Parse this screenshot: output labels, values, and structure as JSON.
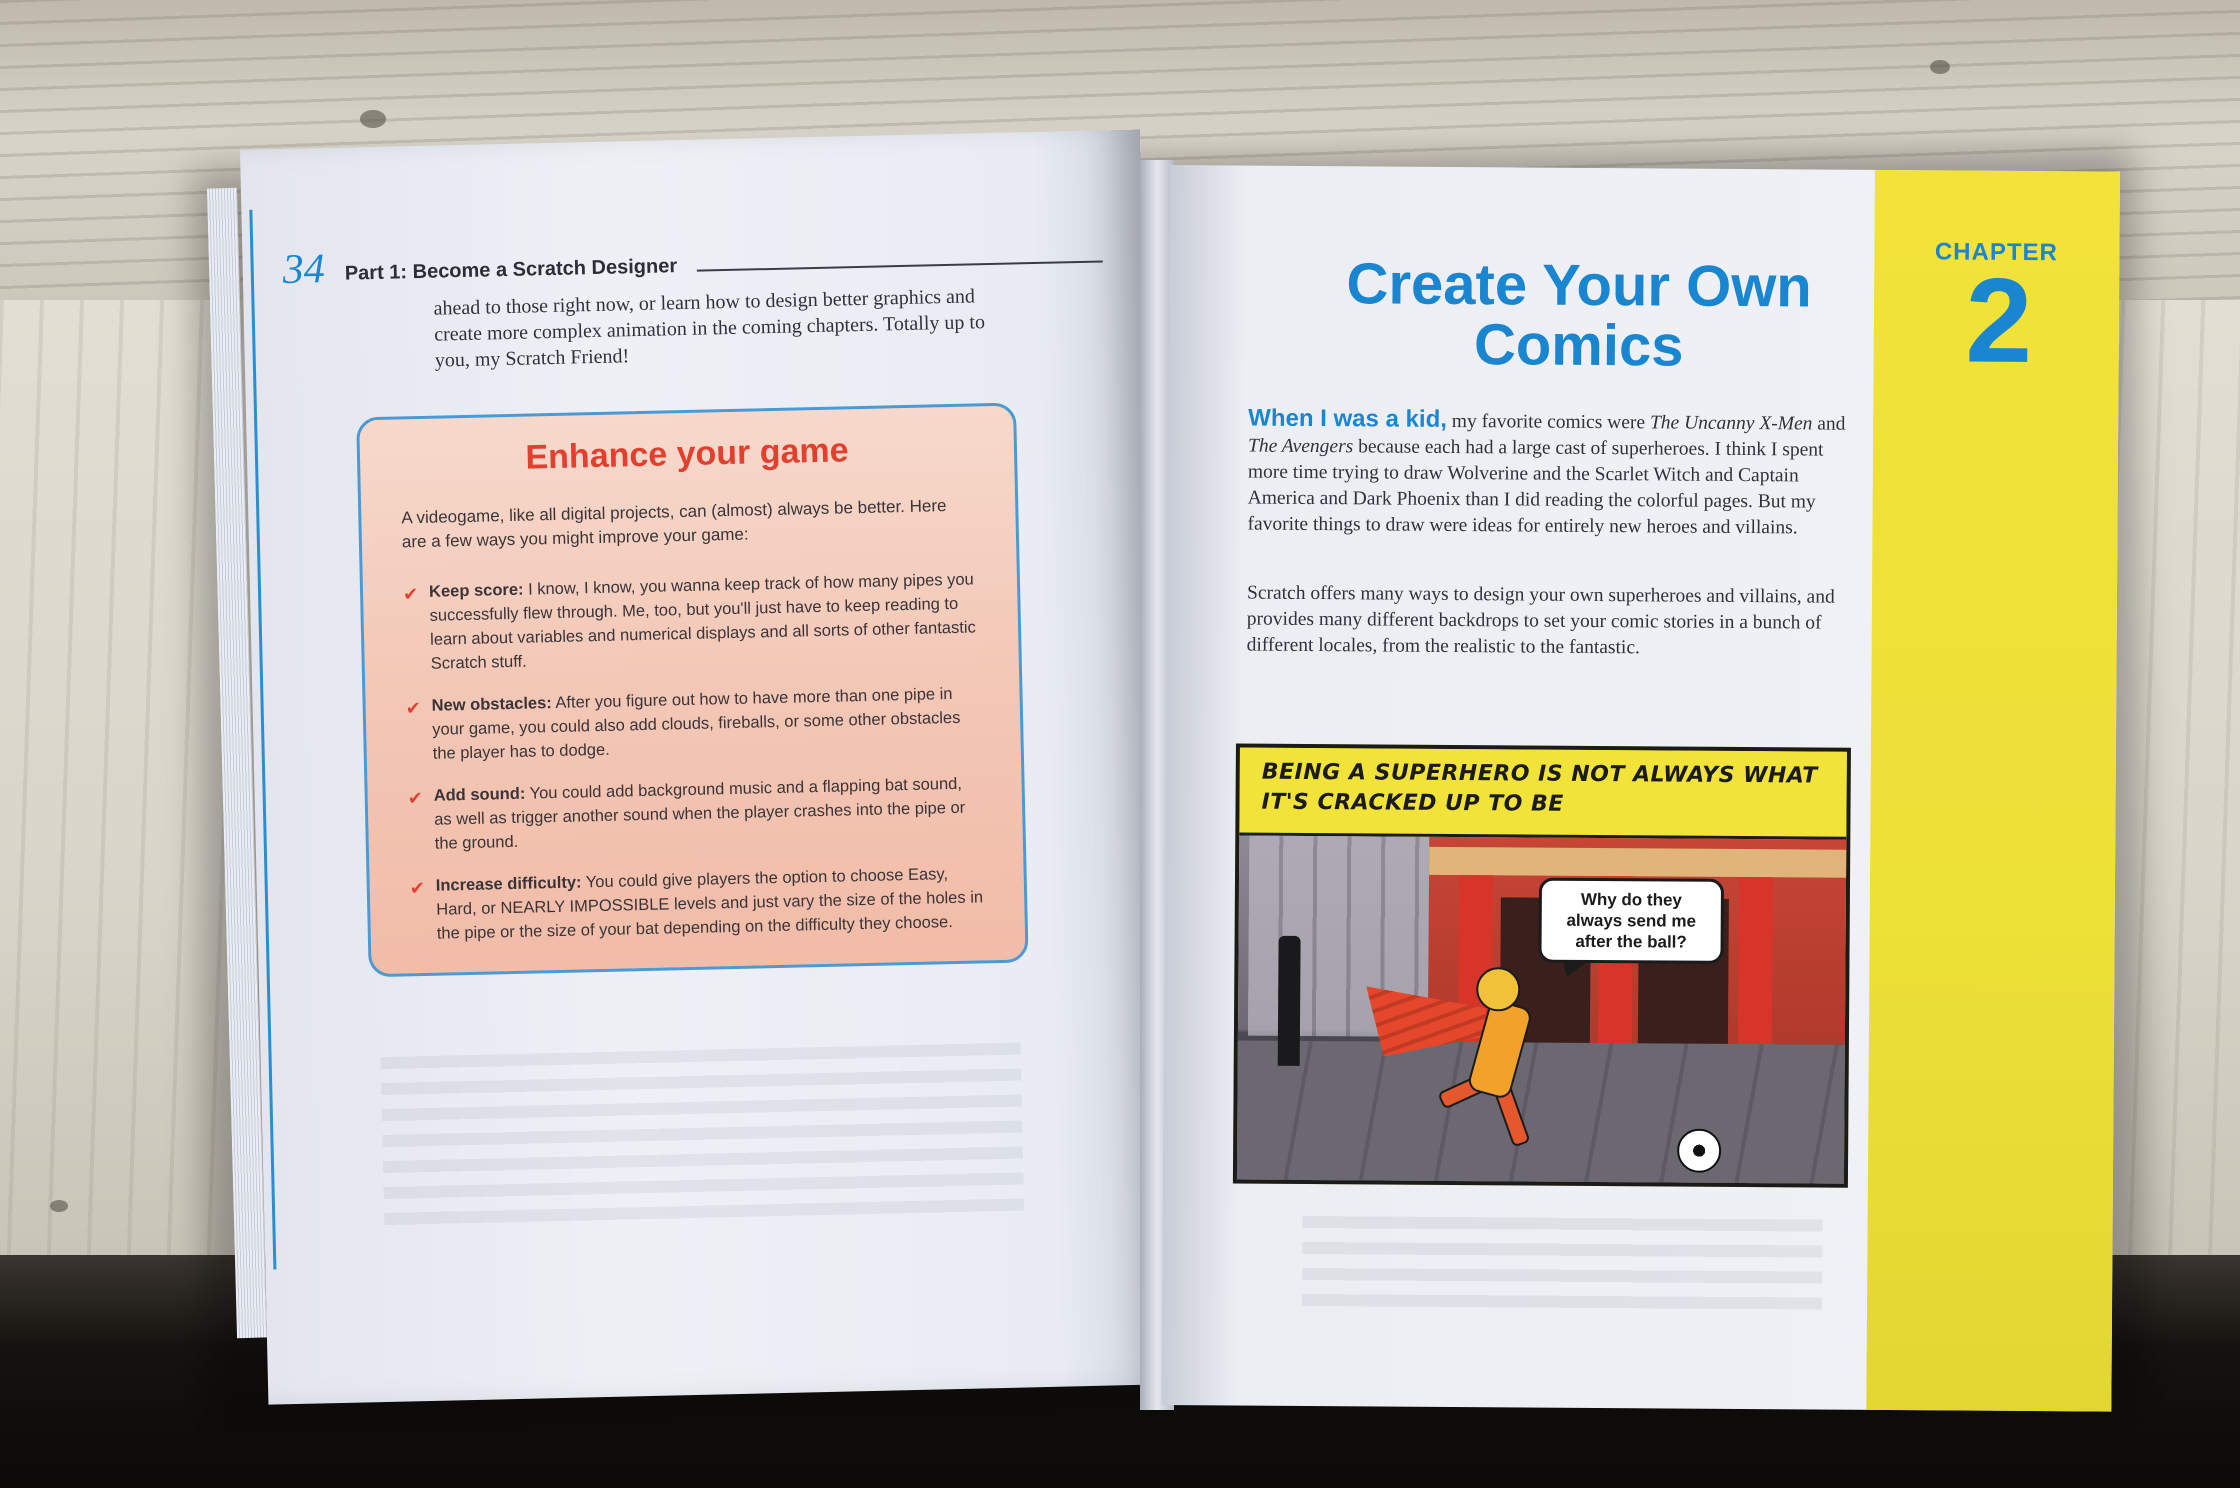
{
  "left_page": {
    "page_number": "34",
    "running_head": "Part 1: Become a Scratch Designer",
    "intro_text": "ahead to those right now, or learn how to design better graphics and create more complex animation in the coming chapters. Totally up to you, my Scratch Friend!",
    "sidebar": {
      "title": "Enhance your game",
      "intro": "A videogame, like all digital projects, can (almost) always be better. Here are a few ways you might improve your game:",
      "items": [
        {
          "lead": "Keep score:",
          "text": " I know, I know, you wanna keep track of how many pipes you successfully flew through. Me, too, but you'll just have to keep reading to learn about variables and numerical displays and all sorts of other fantastic Scratch stuff."
        },
        {
          "lead": "New obstacles:",
          "text": " After you figure out how to have more than one pipe in your game, you could also add clouds, fireballs, or some other obstacles the player has to dodge."
        },
        {
          "lead": "Add sound:",
          "text": " You could add background music and a flapping bat sound, as well as trigger another sound when the player crashes into the pipe or the ground."
        },
        {
          "lead": "Increase difficulty:",
          "text": " You could give players the option to choose Easy, Hard, or NEARLY IMPOSSIBLE levels and just vary the size of the holes in the pipe or the size of your bat depending on the difficulty they choose."
        }
      ]
    }
  },
  "right_page": {
    "chapter_label": "CHAPTER",
    "chapter_number": "2",
    "chapter_title": "Create Your Own Comics",
    "lead_in": "When I was a kid,",
    "para1_a": " my favorite comics were ",
    "para1_em1": "The Uncanny X-Men",
    "para1_b": " and ",
    "para1_em2": "The Avengers",
    "para1_c": " because each had a large cast of superheroes. I think I spent more time trying to draw Wolverine and the Scarlet Witch and Captain America and Dark Phoenix than I did reading the colorful pages. But my favorite things to draw were ideas for entirely new heroes and villains.",
    "para2": "Scratch offers many ways to design your own superheroes and villains, and provides many different backdrops to set your comic stories in a bunch of different locales, from the realistic to the fantastic.",
    "comic": {
      "caption": "Being a superhero is not always what it's cracked up to be",
      "speech": "Why do they always send me after the ball?"
    }
  },
  "colors": {
    "accent_blue": "#1a86d0",
    "sidebar_red": "#e2402f",
    "band_yellow": "#f2e23a"
  }
}
